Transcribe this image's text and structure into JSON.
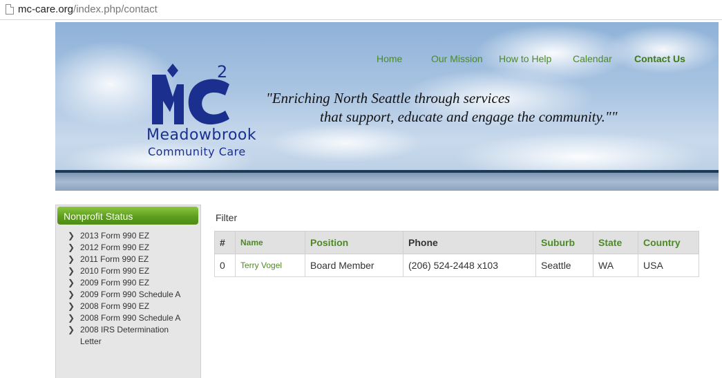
{
  "browser": {
    "url_domain": "mc-care.org",
    "url_path": "/index.php/contact"
  },
  "nav": [
    "Home",
    "Our Mission",
    "How to Help",
    "Calendar",
    "Contact Us"
  ],
  "logo": {
    "line1": "Meadowbrook",
    "line2": "Community Care",
    "mark_text": "MC",
    "superscript": "2"
  },
  "tagline": {
    "line1": "\"Enriching North Seattle through services",
    "line2": "that support, educate and engage the community.\"\""
  },
  "sidebar": {
    "title": "Nonprofit Status",
    "items": [
      "2013 Form 990 EZ",
      "2012 Form 990 EZ",
      "2011 Form 990 EZ",
      "2010 Form 990 EZ",
      "2009 Form 990 EZ",
      "2009 Form 990 Schedule A",
      "2008 Form 990 EZ",
      "2008 Form 990 Schedule A",
      "2008 IRS Determination Letter"
    ]
  },
  "main": {
    "filter_label": "Filter",
    "table": {
      "headers": [
        "#",
        "Name",
        "Position",
        "Phone",
        "Suburb",
        "State",
        "Country"
      ],
      "rows": [
        [
          "0",
          "Terry Vogel",
          "Board Member",
          "(206) 524-2448 x103",
          "Seattle",
          "WA",
          "USA"
        ]
      ]
    }
  },
  "colors": {
    "accent_green": "#4b8b22",
    "logo_blue": "#1b2f8e"
  }
}
